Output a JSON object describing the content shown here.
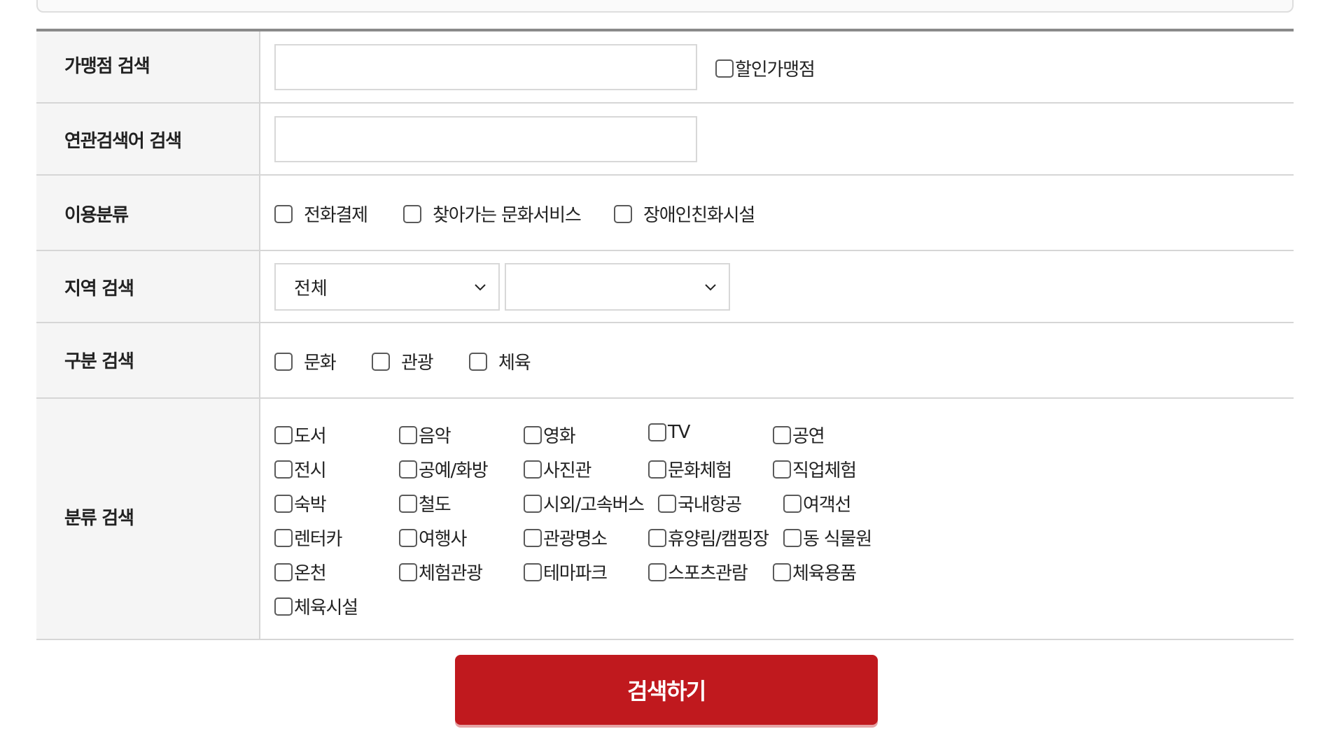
{
  "form": {
    "store_search": {
      "label": "가맹점 검색",
      "input_value": "",
      "discount_checkbox_label": "할인가맹점"
    },
    "keyword_search": {
      "label": "연관검색어 검색",
      "input_value": ""
    },
    "usage_category": {
      "label": "이용분류",
      "options": [
        "전화결제",
        "찾아가는 문화서비스",
        "장애인친화시설"
      ]
    },
    "region_search": {
      "label": "지역 검색",
      "select1_value": "전체",
      "select2_value": ""
    },
    "type_search": {
      "label": "구분 검색",
      "options": [
        "문화",
        "관광",
        "체육"
      ]
    },
    "category_search": {
      "label": "분류 검색",
      "rows": [
        [
          "도서",
          "음악",
          "영화",
          "TV",
          "공연"
        ],
        [
          "전시",
          "공예/화방",
          "사진관",
          "문화체험",
          "직업체험"
        ],
        [
          "숙박",
          "철도",
          "시외/고속버스",
          "국내항공",
          "여객선"
        ],
        [
          "렌터카",
          "여행사",
          "관광명소",
          "휴양림/캠핑장",
          "동 식물원"
        ],
        [
          "온천",
          "체험관광",
          "테마파크",
          "스포츠관람",
          "체육용품"
        ],
        [
          "체육시설"
        ]
      ]
    }
  },
  "search_button_label": "검색하기",
  "icons": {
    "select_arrow": "chevron-down-icon"
  },
  "colors": {
    "button_bg": "#c0191e",
    "label_bg": "#f5f5f5",
    "border": "#d6d6d6"
  }
}
